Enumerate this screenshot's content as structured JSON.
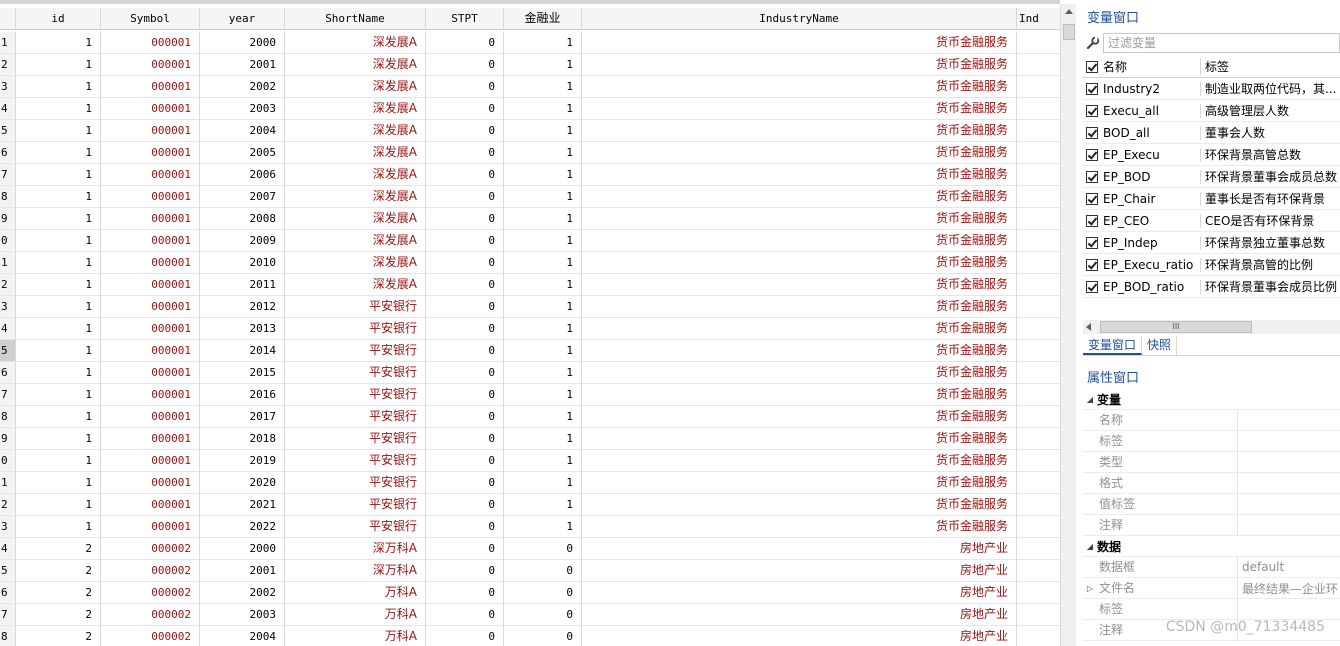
{
  "grid": {
    "columns": [
      "id",
      "Symbol",
      "year",
      "ShortName",
      "STPT",
      "金融业",
      "IndustryName",
      "Ind"
    ],
    "rows": [
      {
        "rn": "1",
        "id": "1",
        "symbol": "000001",
        "year": "2000",
        "short": "深发展A",
        "stpt": "0",
        "fin": "1",
        "ind": "货币金融服务"
      },
      {
        "rn": "2",
        "id": "1",
        "symbol": "000001",
        "year": "2001",
        "short": "深发展A",
        "stpt": "0",
        "fin": "1",
        "ind": "货币金融服务"
      },
      {
        "rn": "3",
        "id": "1",
        "symbol": "000001",
        "year": "2002",
        "short": "深发展A",
        "stpt": "0",
        "fin": "1",
        "ind": "货币金融服务"
      },
      {
        "rn": "4",
        "id": "1",
        "symbol": "000001",
        "year": "2003",
        "short": "深发展A",
        "stpt": "0",
        "fin": "1",
        "ind": "货币金融服务"
      },
      {
        "rn": "5",
        "id": "1",
        "symbol": "000001",
        "year": "2004",
        "short": "深发展A",
        "stpt": "0",
        "fin": "1",
        "ind": "货币金融服务"
      },
      {
        "rn": "6",
        "id": "1",
        "symbol": "000001",
        "year": "2005",
        "short": "深发展A",
        "stpt": "0",
        "fin": "1",
        "ind": "货币金融服务"
      },
      {
        "rn": "7",
        "id": "1",
        "symbol": "000001",
        "year": "2006",
        "short": "深发展A",
        "stpt": "0",
        "fin": "1",
        "ind": "货币金融服务"
      },
      {
        "rn": "8",
        "id": "1",
        "symbol": "000001",
        "year": "2007",
        "short": "深发展A",
        "stpt": "0",
        "fin": "1",
        "ind": "货币金融服务"
      },
      {
        "rn": "9",
        "id": "1",
        "symbol": "000001",
        "year": "2008",
        "short": "深发展A",
        "stpt": "0",
        "fin": "1",
        "ind": "货币金融服务"
      },
      {
        "rn": "0",
        "id": "1",
        "symbol": "000001",
        "year": "2009",
        "short": "深发展A",
        "stpt": "0",
        "fin": "1",
        "ind": "货币金融服务"
      },
      {
        "rn": "1",
        "id": "1",
        "symbol": "000001",
        "year": "2010",
        "short": "深发展A",
        "stpt": "0",
        "fin": "1",
        "ind": "货币金融服务"
      },
      {
        "rn": "2",
        "id": "1",
        "symbol": "000001",
        "year": "2011",
        "short": "深发展A",
        "stpt": "0",
        "fin": "1",
        "ind": "货币金融服务"
      },
      {
        "rn": "3",
        "id": "1",
        "symbol": "000001",
        "year": "2012",
        "short": "平安银行",
        "stpt": "0",
        "fin": "1",
        "ind": "货币金融服务"
      },
      {
        "rn": "4",
        "id": "1",
        "symbol": "000001",
        "year": "2013",
        "short": "平安银行",
        "stpt": "0",
        "fin": "1",
        "ind": "货币金融服务"
      },
      {
        "rn": "5",
        "id": "1",
        "symbol": "000001",
        "year": "2014",
        "short": "平安银行",
        "stpt": "0",
        "fin": "1",
        "ind": "货币金融服务"
      },
      {
        "rn": "6",
        "id": "1",
        "symbol": "000001",
        "year": "2015",
        "short": "平安银行",
        "stpt": "0",
        "fin": "1",
        "ind": "货币金融服务"
      },
      {
        "rn": "7",
        "id": "1",
        "symbol": "000001",
        "year": "2016",
        "short": "平安银行",
        "stpt": "0",
        "fin": "1",
        "ind": "货币金融服务"
      },
      {
        "rn": "8",
        "id": "1",
        "symbol": "000001",
        "year": "2017",
        "short": "平安银行",
        "stpt": "0",
        "fin": "1",
        "ind": "货币金融服务"
      },
      {
        "rn": "9",
        "id": "1",
        "symbol": "000001",
        "year": "2018",
        "short": "平安银行",
        "stpt": "0",
        "fin": "1",
        "ind": "货币金融服务"
      },
      {
        "rn": "0",
        "id": "1",
        "symbol": "000001",
        "year": "2019",
        "short": "平安银行",
        "stpt": "0",
        "fin": "1",
        "ind": "货币金融服务"
      },
      {
        "rn": "1",
        "id": "1",
        "symbol": "000001",
        "year": "2020",
        "short": "平安银行",
        "stpt": "0",
        "fin": "1",
        "ind": "货币金融服务"
      },
      {
        "rn": "2",
        "id": "1",
        "symbol": "000001",
        "year": "2021",
        "short": "平安银行",
        "stpt": "0",
        "fin": "1",
        "ind": "货币金融服务"
      },
      {
        "rn": "3",
        "id": "1",
        "symbol": "000001",
        "year": "2022",
        "short": "平安银行",
        "stpt": "0",
        "fin": "1",
        "ind": "货币金融服务"
      },
      {
        "rn": "4",
        "id": "2",
        "symbol": "000002",
        "year": "2000",
        "short": "深万科A",
        "stpt": "0",
        "fin": "0",
        "ind": "房地产业"
      },
      {
        "rn": "5",
        "id": "2",
        "symbol": "000002",
        "year": "2001",
        "short": "深万科A",
        "stpt": "0",
        "fin": "0",
        "ind": "房地产业"
      },
      {
        "rn": "6",
        "id": "2",
        "symbol": "000002",
        "year": "2002",
        "short": "万科A",
        "stpt": "0",
        "fin": "0",
        "ind": "房地产业"
      },
      {
        "rn": "7",
        "id": "2",
        "symbol": "000002",
        "year": "2003",
        "short": "万科A",
        "stpt": "0",
        "fin": "0",
        "ind": "房地产业"
      },
      {
        "rn": "8",
        "id": "2",
        "symbol": "000002",
        "year": "2004",
        "short": "万科A",
        "stpt": "0",
        "fin": "0",
        "ind": "房地产业"
      }
    ],
    "selected_row_index": 14
  },
  "var_panel": {
    "title": "变量窗口",
    "filter_placeholder": "过滤变量",
    "col_name": "名称",
    "col_label": "标签",
    "vars": [
      {
        "name": "Industry2",
        "label": "制造业取两位代码，其..."
      },
      {
        "name": "Execu_all",
        "label": "高级管理层人数"
      },
      {
        "name": "BOD_all",
        "label": "董事会人数"
      },
      {
        "name": "EP_Execu",
        "label": "环保背景高管总数"
      },
      {
        "name": "EP_BOD",
        "label": "环保背景董事会成员总数"
      },
      {
        "name": "EP_Chair",
        "label": "董事长是否有环保背景"
      },
      {
        "name": "EP_CEO",
        "label": "CEO是否有环保背景"
      },
      {
        "name": "EP_Indep",
        "label": "环保背景独立董事总数"
      },
      {
        "name": "EP_Execu_ratio",
        "label": "环保背景高管的比例"
      },
      {
        "name": "EP_BOD_ratio",
        "label": "环保背景董事会成员比例"
      }
    ],
    "scroll_thumb_text": "III",
    "tabs": [
      "变量窗口",
      "快照"
    ]
  },
  "prop_panel": {
    "title": "属性窗口",
    "group_var": "变量",
    "var_rows": [
      {
        "key": "名称",
        "value": ""
      },
      {
        "key": "标签",
        "value": ""
      },
      {
        "key": "类型",
        "value": ""
      },
      {
        "key": "格式",
        "value": ""
      },
      {
        "key": "值标签",
        "value": ""
      },
      {
        "key": "注释",
        "value": ""
      }
    ],
    "group_data": "数据",
    "data_rows": [
      {
        "key": "数据框",
        "value": "default",
        "expand": ""
      },
      {
        "key": "文件名",
        "value": "最终结果—企业环",
        "expand": "▷"
      },
      {
        "key": "标签",
        "value": "",
        "expand": ""
      },
      {
        "key": "注释",
        "value": "",
        "expand": ""
      }
    ]
  },
  "watermark": "CSDN @m0_71334485"
}
